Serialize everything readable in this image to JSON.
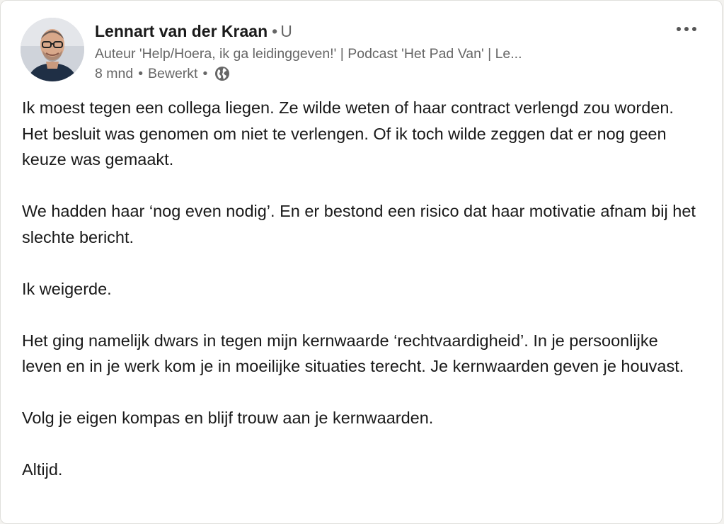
{
  "author": {
    "name": "Lennart van der Kraan",
    "separator": "•",
    "degree": "U",
    "headline": "Auteur 'Help/Hoera, ik ga leidinggeven!' | Podcast 'Het Pad Van' | Le...",
    "time": "8 mnd",
    "edited": "Bewerkt",
    "dot": "•",
    "visibility_icon": "globe-icon"
  },
  "menu": {
    "icon": "more-options-icon"
  },
  "post": {
    "paragraphs": [
      "Ik moest tegen een collega liegen. Ze wilde weten of haar contract verlengd zou worden. Het besluit was genomen om niet te verlengen. Of ik toch wilde zeggen dat er nog geen keuze was gemaakt.",
      "We hadden haar ‘nog even nodig’. En er bestond een risico dat haar motivatie afnam bij het slechte bericht.",
      "Ik weigerde.",
      "Het ging namelijk dwars in tegen mijn kernwaarde ‘rechtvaardigheid’. In je persoonlijke leven en in je werk kom je in moeilijke situaties terecht. Je kernwaarden geven je houvast.",
      "Volg je eigen kompas en blijf trouw aan je kernwaarden.",
      "Altijd."
    ]
  },
  "colors": {
    "text": "#191919",
    "secondary": "#666666",
    "card": "#ffffff",
    "page": "#f3f2ef"
  }
}
